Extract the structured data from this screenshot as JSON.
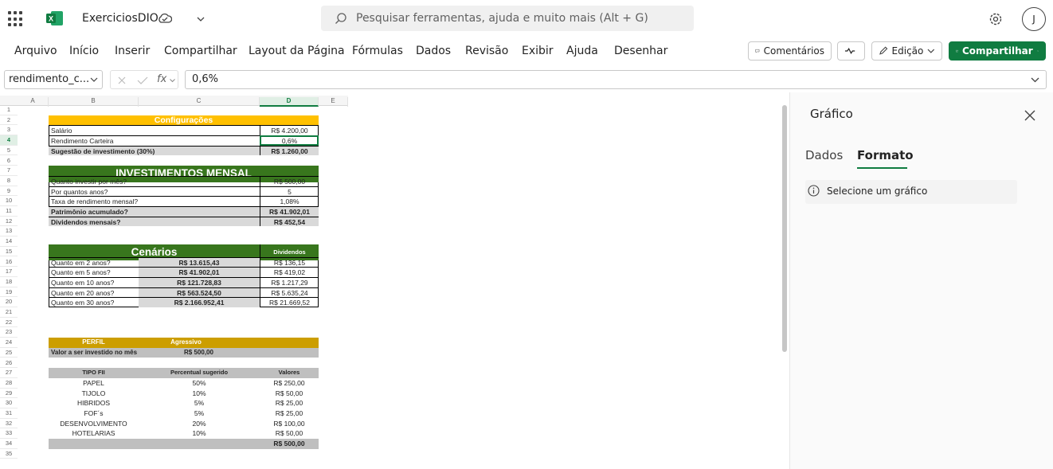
{
  "app": {
    "file_name": "ExerciciosDIO",
    "search_placeholder": "Pesquisar ferramentas, ajuda e muito mais (Alt + G)",
    "avatar": "J"
  },
  "ribbon": {
    "tabs": [
      "Arquivo",
      "Início",
      "Inserir",
      "Compartilhar",
      "Layout da Página",
      "Fórmulas",
      "Dados",
      "Revisão",
      "Exibir",
      "Ajuda",
      "Desenhar"
    ],
    "comments": "Comentários",
    "edit_mode": "Edição",
    "share": "Compartilhar"
  },
  "formula_bar": {
    "name_box": "rendimento_c...",
    "value": "0,6%",
    "fx": "fx"
  },
  "sheet": {
    "columns": [
      "A",
      "B",
      "C",
      "D",
      "E"
    ],
    "rows": [
      "1",
      "2",
      "3",
      "4",
      "5",
      "6",
      "7",
      "8",
      "9",
      "10",
      "11",
      "12",
      "13",
      "14",
      "15",
      "16",
      "17",
      "18",
      "19",
      "20",
      "21",
      "22",
      "23",
      "24",
      "25",
      "26",
      "27",
      "28",
      "29",
      "30",
      "31",
      "32",
      "33",
      "34",
      "35"
    ],
    "config": {
      "title": "Configurações",
      "rows": [
        [
          "Salário",
          "R$ 4.200,00"
        ],
        [
          "Rendimento Carteira",
          "0,6%"
        ],
        [
          "Sugestão de investimento (30%)",
          "R$ 1.260,00"
        ]
      ]
    },
    "invest": {
      "title": "INVESTIMENTOS MENSAL",
      "rows": [
        [
          "Quanto investir por mês?",
          "R$ 500,00"
        ],
        [
          "Por quantos anos?",
          "5"
        ],
        [
          "Taxa de rendimento mensal?",
          "1,08%"
        ],
        [
          "Patrimônio acumulado?",
          "R$ 41.902,01"
        ],
        [
          "Dividendos mensais?",
          "R$ 452,54"
        ]
      ]
    },
    "cenarios": {
      "title": "Cenários",
      "dividendos": "Dividendos",
      "rows": [
        [
          "Quanto em 2 anos?",
          "R$ 13.615,43",
          "R$ 136,15"
        ],
        [
          "Quanto em 5 anos?",
          "R$ 41.902,01",
          "R$ 419,02"
        ],
        [
          "Quanto em 10 anos?",
          "R$ 121.728,83",
          "R$ 1.217,29"
        ],
        [
          "Quanto em 20 anos?",
          "R$ 563.524,50",
          "R$ 5.635,24"
        ],
        [
          "Quanto em 30 anos?",
          "R$ 2.166.952,41",
          "R$ 21.669,52"
        ]
      ]
    },
    "perfil": {
      "label": "PERFIL",
      "value": "Agressivo",
      "valor_label": "Valor a ser investido no mês",
      "valor": "R$ 500,00"
    },
    "fii": {
      "headers": [
        "TIPO FII",
        "Percentual sugerido",
        "Valores"
      ],
      "rows": [
        [
          "PAPEL",
          "50%",
          "R$ 250,00"
        ],
        [
          "TIJOLO",
          "10%",
          "R$ 50,00"
        ],
        [
          "HIBRIDOS",
          "5%",
          "R$ 25,00"
        ],
        [
          "FOF´s",
          "5%",
          "R$ 25,00"
        ],
        [
          "DESENVOLVIMENTO",
          "20%",
          "R$ 100,00"
        ],
        [
          "HOTELARIAS",
          "10%",
          "R$ 50,00"
        ]
      ],
      "total": "R$ 500,00"
    }
  },
  "side_panel": {
    "title": "Gráfico",
    "tabs": [
      "Dados",
      "Formato"
    ],
    "message": "Selecione um gráfico"
  },
  "colors": {
    "excel_green": "#107c41",
    "config_header": "#ffc000",
    "invest_header": "#38761d",
    "perfil": "#cc9e00",
    "gray_row": "#d9d9d9"
  }
}
